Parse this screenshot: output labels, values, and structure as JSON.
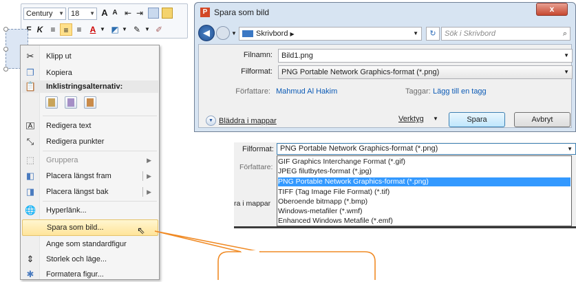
{
  "mini_toolbar": {
    "font_name": "Century",
    "font_size": "18",
    "grow_font": "A",
    "shrink_font": "A",
    "bold": "F",
    "italic": "K",
    "font_color_letter": "A"
  },
  "context_menu": {
    "items": [
      {
        "label": "Klipp ut",
        "icon": "scissors-icon"
      },
      {
        "label": "Kopiera",
        "icon": "copy-icon"
      },
      {
        "label": "Inklistringsalternativ:",
        "icon": "paste-icon"
      },
      {
        "label": "Redigera text",
        "icon": "edit-text-icon"
      },
      {
        "label": "Redigera punkter",
        "icon": "edit-points-icon"
      },
      {
        "label": "Gruppera",
        "icon": "group-icon",
        "disabled": true
      },
      {
        "label": "Placera längst fram",
        "icon": "bring-front-icon"
      },
      {
        "label": "Placera längst bak",
        "icon": "send-back-icon"
      },
      {
        "label": "Hyperlänk...",
        "icon": "hyperlink-icon"
      },
      {
        "label": "Spara som bild...",
        "icon": "",
        "highlighted": true
      },
      {
        "label": "Ange som standardfigur",
        "icon": ""
      },
      {
        "label": "Storlek och läge...",
        "icon": "size-position-icon"
      },
      {
        "label": "Formatera figur...",
        "icon": "format-shape-icon"
      }
    ]
  },
  "dialog": {
    "title": "Spara som bild",
    "app_letter": "P",
    "close_glyph": "x",
    "location": "Skrivbord",
    "search_placeholder": "Sök i Skrivbord",
    "filename_label": "Filnamn:",
    "filename_value": "Bild1.png",
    "format_label": "Filformat:",
    "format_value": "PNG Portable Network Graphics-format (*.png)",
    "author_label": "Författare:",
    "author_value": "Mahmud Al Hakim",
    "tags_label": "Taggar:",
    "tags_value": "Lägg till en tagg",
    "browse_label": "Bläddra i mappar",
    "tools_label": "Verktyg",
    "save_button": "Spara",
    "cancel_button": "Avbryt"
  },
  "format_dropdown": {
    "label": "Filformat:",
    "selected_value": "PNG Portable Network Graphics-format (*.png)",
    "author_label": "Författare:",
    "browse_fragment": "ra i mappar",
    "options": [
      "GIF Graphics Interchange Format (*.gif)",
      "JPEG filutbytes-format (*.jpg)",
      "PNG Portable Network Graphics-format (*.png)",
      "TIFF (Tag Image File Format) (*.tif)",
      "Oberoende bitmapp (*.bmp)",
      "Windows-metafiler (*.wmf)",
      "Enhanced Windows Metafile (*.emf)"
    ],
    "selected_index": 2
  },
  "colors": {
    "highlight": "#ffe49a",
    "selection": "#3399ff",
    "callout_stroke": "#f08a24"
  }
}
